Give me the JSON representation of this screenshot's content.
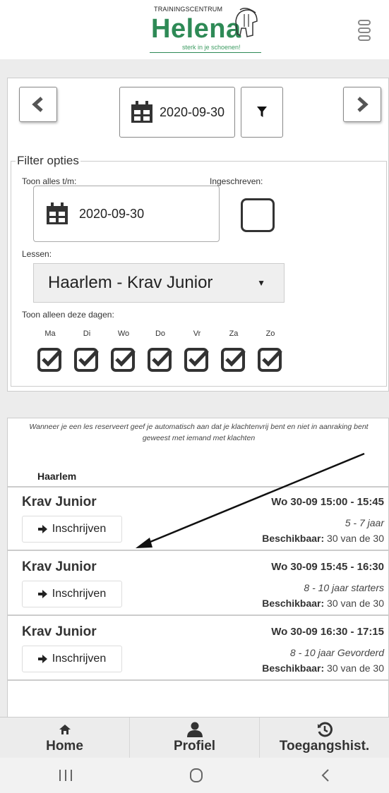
{
  "header": {
    "logo_small": "TRAININGSCENTRUM",
    "logo_big": "Helena",
    "logo_tagline": "sterk in je schoenen!"
  },
  "date_nav": {
    "date": "2020-09-30",
    "prev_icon": "chevron-left-icon",
    "next_icon": "chevron-right-icon"
  },
  "filter": {
    "legend": "Filter opties",
    "show_until_label": "Toon alles t/m:",
    "show_until_value": "2020-09-30",
    "registered_label": "Ingeschreven:",
    "lessons_label": "Lessen:",
    "lessons_value": "Haarlem - Krav Junior",
    "days_label": "Toon alleen deze dagen:",
    "days": [
      "Ma",
      "Di",
      "Wo",
      "Do",
      "Vr",
      "Za",
      "Zo"
    ]
  },
  "notice": "Wanneer je een les reserveert geef je automatisch aan dat je klachtenvrij bent en niet in aanraking bent geweest met iemand met klachten",
  "location": "Haarlem",
  "lessons": [
    {
      "title": "Krav Junior",
      "when": "Wo 30-09 15:00 - 15:45",
      "button": "Inschrijven",
      "age": "5 - 7 jaar",
      "avail_label": "Beschikbaar:",
      "avail_value": "30 van de 30"
    },
    {
      "title": "Krav Junior",
      "when": "Wo 30-09 15:45 - 16:30",
      "button": "Inschrijven",
      "age": "8 - 10 jaar starters",
      "avail_label": "Beschikbaar:",
      "avail_value": "30 van de 30"
    },
    {
      "title": "Krav Junior",
      "when": "Wo 30-09 16:30 - 17:15",
      "button": "Inschrijven",
      "age": "8 - 10 jaar Gevorderd",
      "avail_label": "Beschikbaar:",
      "avail_value": "30 van de 30"
    }
  ],
  "tabs": [
    {
      "label": "Home",
      "icon": "home-icon"
    },
    {
      "label": "Profiel",
      "icon": "user-icon"
    },
    {
      "label": "Toegangshist.",
      "icon": "history-icon"
    }
  ],
  "colors": {
    "brand_green": "#2e8a56"
  }
}
